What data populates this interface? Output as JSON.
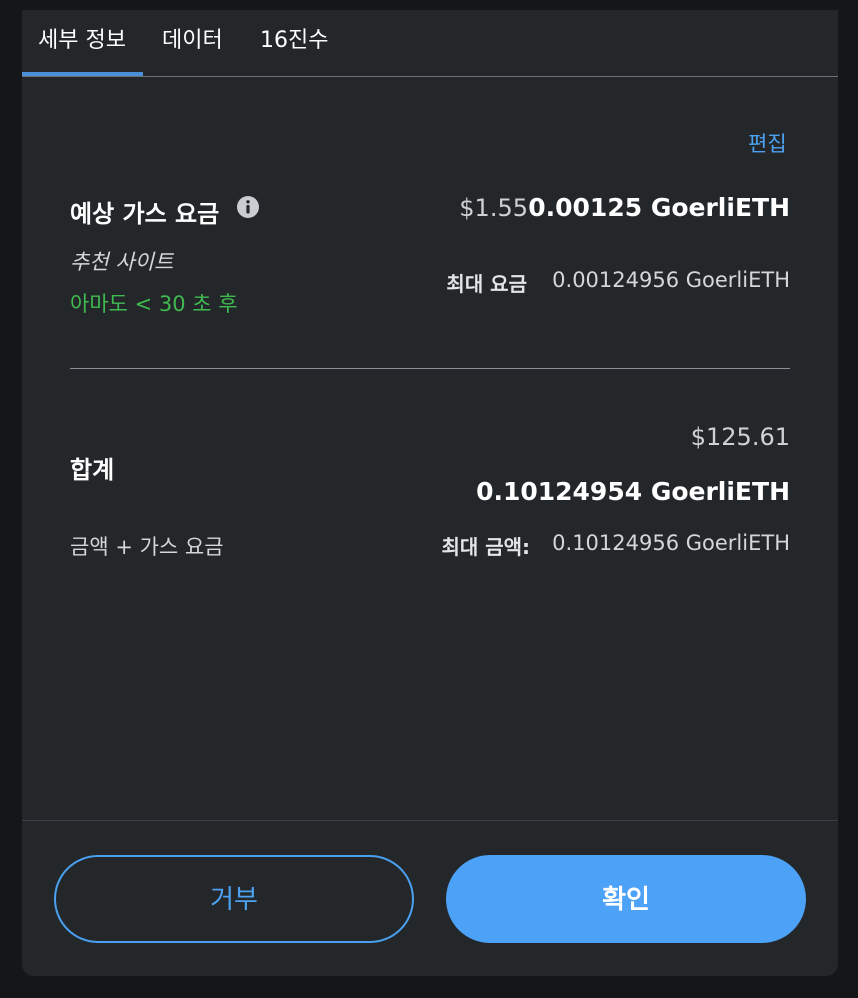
{
  "tabs": [
    {
      "label": "세부 정보",
      "active": true
    },
    {
      "label": "데이터",
      "active": false
    },
    {
      "label": "16진수",
      "active": false
    }
  ],
  "edit_label": "편집",
  "gas": {
    "label": "예상 가스 요금",
    "fiat": "$1.55",
    "eth": "0.00125 GoerliETH",
    "suggested": "추천 사이트",
    "timing": "아마도 < 30 초 후",
    "max_fee_label": "최대 요금",
    "max_fee_value": "0.00124956 GoerliETH"
  },
  "total": {
    "label": "합계",
    "fiat": "$125.61",
    "eth": "0.10124954 GoerliETH",
    "subtitle": "금액 + 가스 요금",
    "max_amount_label": "최대 금액:",
    "max_amount_value": "0.10124956 GoerliETH"
  },
  "buttons": {
    "reject": "거부",
    "confirm": "확인"
  },
  "colors": {
    "accent": "#4ca2f7",
    "success": "#3fb950",
    "background": "#24272a"
  },
  "icons": {
    "info": "info-icon"
  }
}
